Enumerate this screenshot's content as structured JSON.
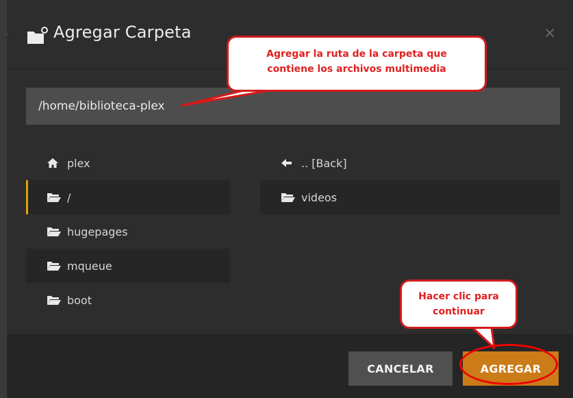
{
  "dialog": {
    "title": "Agregar Carpeta",
    "close_label": "×",
    "path_value": "/home/biblioteca-plex"
  },
  "left_list": {
    "items": [
      {
        "label": "plex",
        "icon": "home-icon"
      },
      {
        "label": "/",
        "icon": "folder-open-icon",
        "selected": true
      },
      {
        "label": "hugepages",
        "icon": "folder-open-icon"
      },
      {
        "label": "mqueue",
        "icon": "folder-open-icon"
      },
      {
        "label": "boot",
        "icon": "folder-open-icon"
      }
    ]
  },
  "right_list": {
    "items": [
      {
        "label": ".. [Back]",
        "icon": "arrow-left-icon"
      },
      {
        "label": "videos",
        "icon": "folder-open-icon"
      }
    ]
  },
  "footer": {
    "cancel_label": "CANCELAR",
    "add_label": "AGREGAR"
  },
  "annotations": {
    "callout_path_line1": "Agregar la ruta de la carpeta que",
    "callout_path_line2": "contiene los archivos multimedia",
    "callout_click_line1": "Hacer clic para",
    "callout_click_line2": "continuar"
  },
  "colors": {
    "accent": "#e5a00d",
    "add_button": "#cc7b19",
    "annotation_red": "#e02020"
  }
}
